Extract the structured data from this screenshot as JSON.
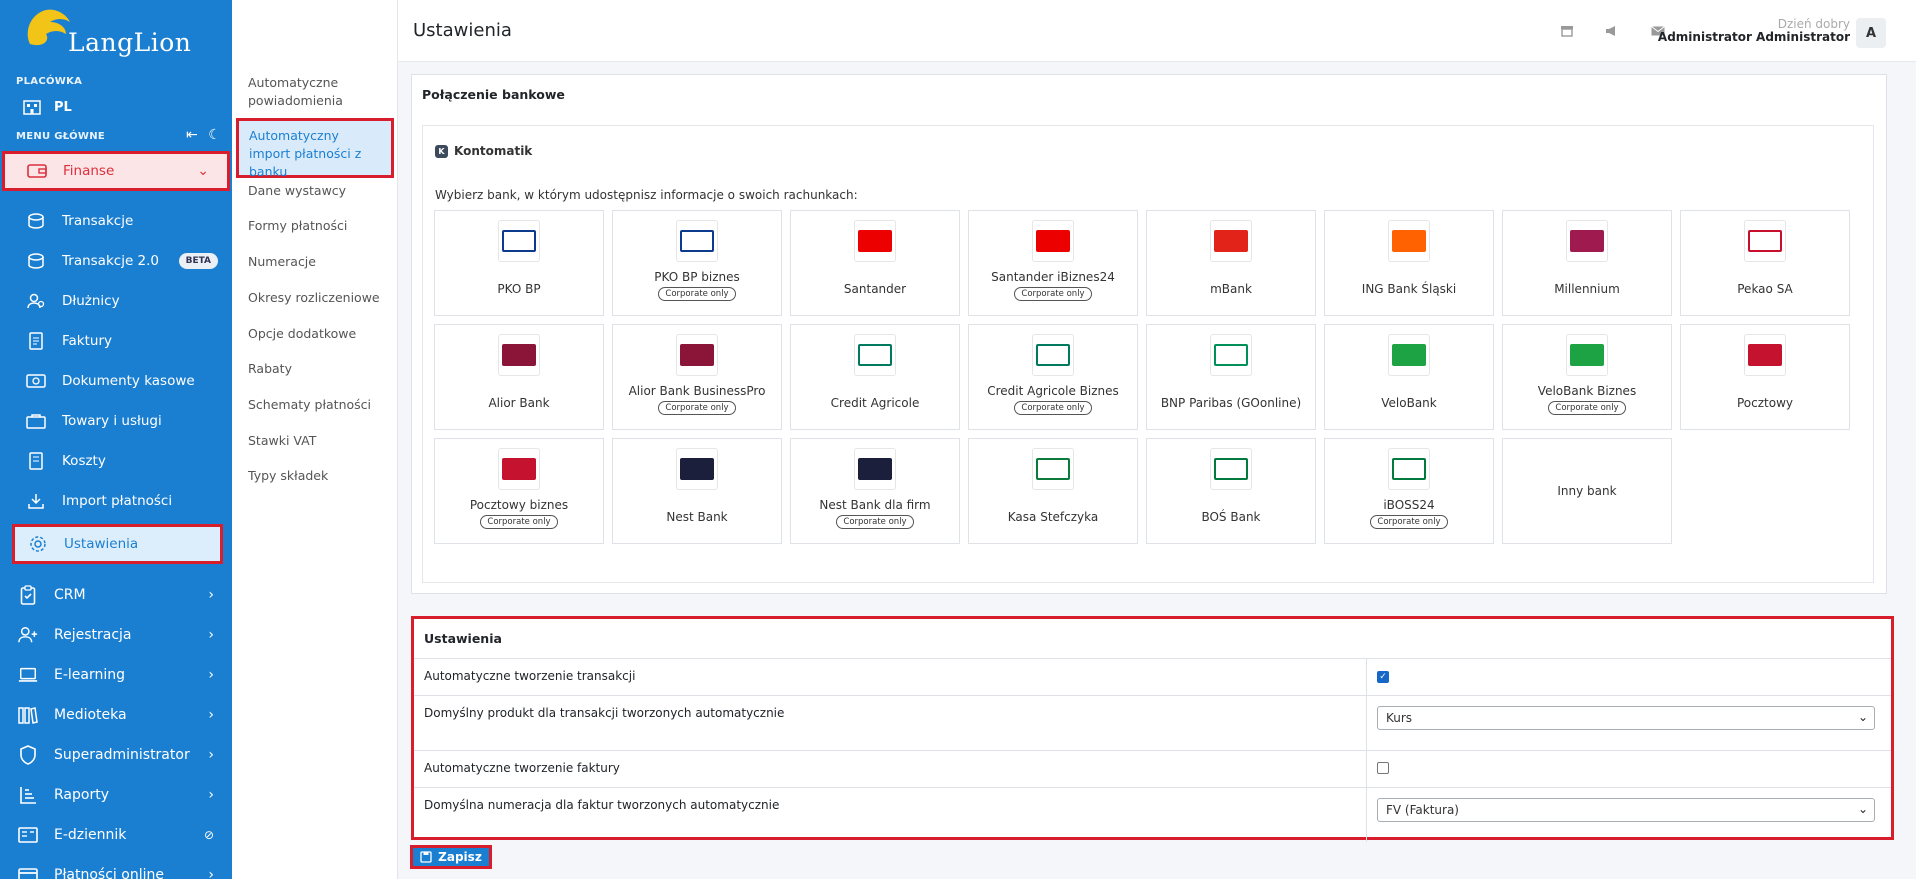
{
  "app": {
    "logo_text": "LangLion"
  },
  "sidebar": {
    "branch_caption": "PLACÓWKA",
    "branch_value": "PL",
    "menu_caption": "MENU GŁÓWNE",
    "finanse": "Finanse",
    "sub_items": [
      {
        "label": "Transakcje",
        "icon": "transactions-icon"
      },
      {
        "label": "Transakcje 2.0",
        "icon": "transactions-icon",
        "badge": "BETA"
      },
      {
        "label": "Dłużnicy",
        "icon": "debtors-icon"
      },
      {
        "label": "Faktury",
        "icon": "invoice-icon"
      },
      {
        "label": "Dokumenty kasowe",
        "icon": "cash-icon"
      },
      {
        "label": "Towary i usługi",
        "icon": "goods-icon"
      },
      {
        "label": "Koszty",
        "icon": "costs-icon"
      },
      {
        "label": "Import płatności",
        "icon": "import-icon"
      },
      {
        "label": "Ustawienia",
        "icon": "gear-icon"
      }
    ],
    "top_items": [
      {
        "label": "CRM"
      },
      {
        "label": "Rejestracja"
      },
      {
        "label": "E-learning"
      },
      {
        "label": "Medioteka"
      },
      {
        "label": "Superadministrator"
      },
      {
        "label": "Raporty"
      },
      {
        "label": "E-dziennik"
      },
      {
        "label": "Płatności online"
      }
    ]
  },
  "submenu": {
    "items": [
      "Automatyczne powiadomienia",
      "Automatyczny import płatności z banku",
      "Dane wystawcy",
      "Formy płatności",
      "Numeracje",
      "Okresy rozliczeniowe",
      "Opcje dodatkowe",
      "Rabaty",
      "Schematy płatności",
      "Stawki VAT",
      "Typy składek"
    ]
  },
  "header": {
    "title": "Ustawienia",
    "greeting": "Dzień dobry",
    "user": "Administrator Administrator",
    "avatar": "A"
  },
  "bank_section": {
    "title": "Połączenie bankowe",
    "provider": "Kontomatik",
    "prompt": "Wybierz bank, w którym udostępnisz informacje o swoich rachunkach:",
    "corporate_label": "Corporate only",
    "banks": [
      {
        "name": "PKO BP",
        "corporate": false,
        "logo_color": "#0a3b8c",
        "logo_bg": "#ffffff"
      },
      {
        "name": "PKO BP biznes",
        "corporate": true,
        "logo_color": "#0a3b8c",
        "logo_bg": "#ffffff"
      },
      {
        "name": "Santander",
        "corporate": false,
        "logo_color": "#ffffff",
        "logo_bg": "#ec0000"
      },
      {
        "name": "Santander iBiznes24",
        "corporate": true,
        "logo_color": "#ffffff",
        "logo_bg": "#ec0000"
      },
      {
        "name": "mBank",
        "corporate": false,
        "logo_color": "#ffffff",
        "logo_bg": "#e2231a"
      },
      {
        "name": "ING Bank Śląski",
        "corporate": false,
        "logo_color": "#ffffff",
        "logo_bg": "#ff6200"
      },
      {
        "name": "Millennium",
        "corporate": false,
        "logo_color": "#ffffff",
        "logo_bg": "#9e1a4f"
      },
      {
        "name": "Pekao SA",
        "corporate": false,
        "logo_color": "#c8102e",
        "logo_bg": "#ffffff"
      },
      {
        "name": "Alior Bank",
        "corporate": false,
        "logo_color": "#ffffff",
        "logo_bg": "#8a1538"
      },
      {
        "name": "Alior Bank BusinessPro",
        "corporate": true,
        "logo_color": "#ffffff",
        "logo_bg": "#8a1538"
      },
      {
        "name": "Credit Agricole",
        "corporate": false,
        "logo_color": "#007a5e",
        "logo_bg": "#ffffff"
      },
      {
        "name": "Credit Agricole Biznes",
        "corporate": true,
        "logo_color": "#007a5e",
        "logo_bg": "#ffffff"
      },
      {
        "name": "BNP Paribas (GOonline)",
        "corporate": false,
        "logo_color": "#00915a",
        "logo_bg": "#ffffff"
      },
      {
        "name": "VeloBank",
        "corporate": false,
        "logo_color": "#ffffff",
        "logo_bg": "#1ea344"
      },
      {
        "name": "VeloBank Biznes",
        "corporate": true,
        "logo_color": "#ffffff",
        "logo_bg": "#1ea344"
      },
      {
        "name": "Pocztowy",
        "corporate": false,
        "logo_color": "#ffffff",
        "logo_bg": "#c4122f"
      },
      {
        "name": "Pocztowy biznes",
        "corporate": true,
        "logo_color": "#ffffff",
        "logo_bg": "#c4122f"
      },
      {
        "name": "Nest Bank",
        "corporate": false,
        "logo_color": "#ffffff",
        "logo_bg": "#1c1f3b"
      },
      {
        "name": "Nest Bank dla firm",
        "corporate": true,
        "logo_color": "#ffffff",
        "logo_bg": "#1c1f3b"
      },
      {
        "name": "Kasa Stefczyka",
        "corporate": false,
        "logo_color": "#0c7a3a",
        "logo_bg": "#ffffff"
      },
      {
        "name": "BOŚ Bank",
        "corporate": false,
        "logo_color": "#007a3d",
        "logo_bg": "#ffffff"
      },
      {
        "name": "iBOSS24",
        "corporate": true,
        "logo_color": "#007a3d",
        "logo_bg": "#ffffff"
      },
      {
        "name": "Inny bank",
        "corporate": false,
        "other": true
      }
    ]
  },
  "settings_section": {
    "title": "Ustawienia",
    "rows": [
      {
        "label": "Automatyczne tworzenie transakcji",
        "type": "checkbox",
        "checked": true
      },
      {
        "label": "Domyślny produkt dla transakcji tworzonych automatycznie",
        "type": "select",
        "value": "Kurs"
      },
      {
        "label": "Automatyczne tworzenie faktury",
        "type": "checkbox",
        "checked": false
      },
      {
        "label": "Domyślna numeracja dla faktur tworzonych automatycznie",
        "type": "select",
        "value": "FV (Faktura)"
      }
    ],
    "save_label": "Zapisz"
  },
  "colors": {
    "sidebar": "#1b7fd1",
    "highlight": "#d81e2c",
    "accent": "#1667c8"
  }
}
